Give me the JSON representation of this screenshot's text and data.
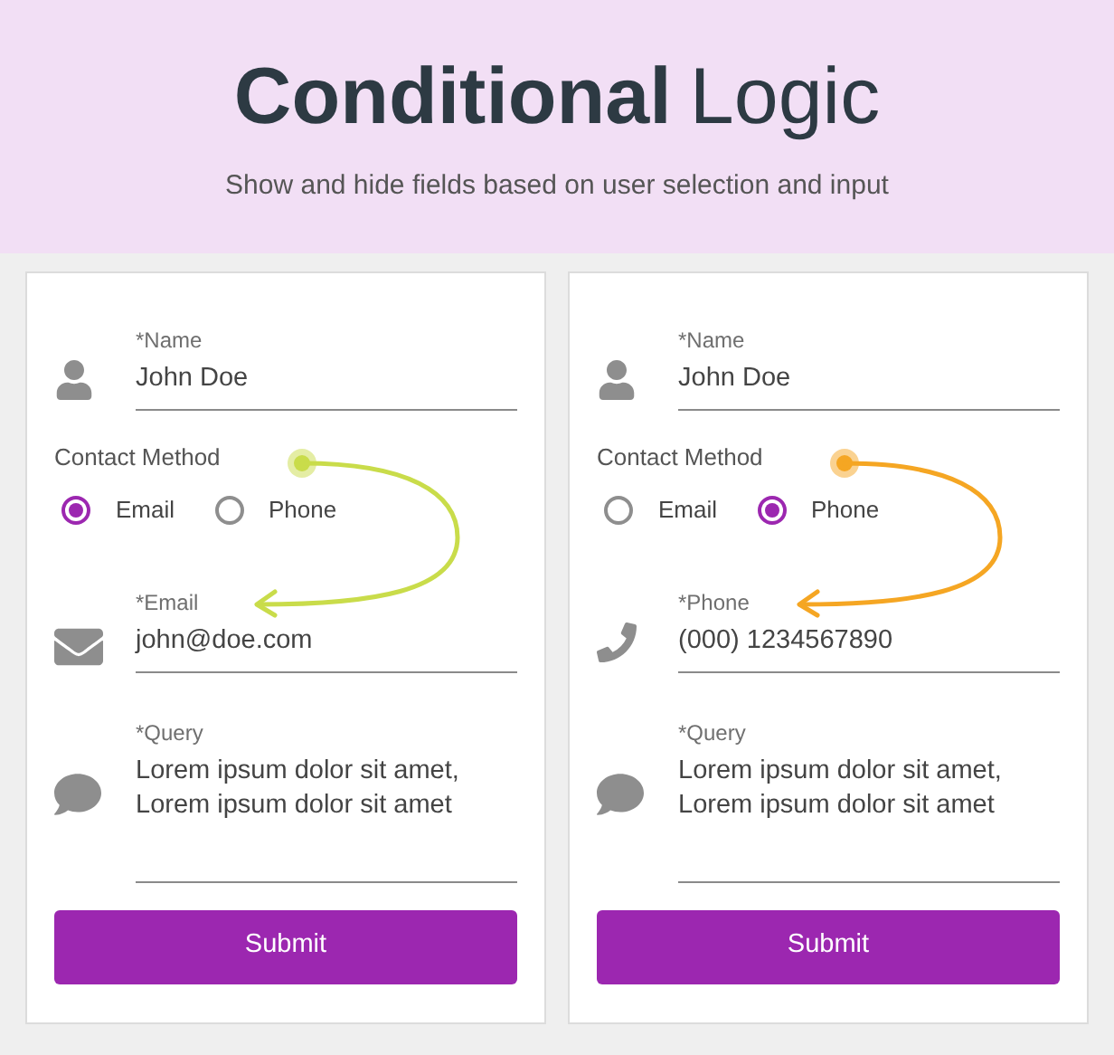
{
  "header": {
    "title_bold": "Conditional",
    "title_light": "Logic",
    "subtitle": "Show and hide fields based on user selection and input"
  },
  "forms": [
    {
      "color": "#c9dc4a",
      "fields_before": [
        {
          "kind": "name",
          "label": "*Name",
          "value": "John Doe"
        }
      ],
      "contact": {
        "label": "Contact Method",
        "options": [
          {
            "label": "Email",
            "selected": true
          },
          {
            "label": "Phone",
            "selected": false
          }
        ]
      },
      "fields_after": [
        {
          "kind": "email",
          "label": "*Email",
          "value": "john@doe.com"
        },
        {
          "kind": "query",
          "label": "*Query",
          "value": "Lorem ipsum dolor sit amet, Lorem ipsum dolor sit amet"
        }
      ],
      "submit": "Submit"
    },
    {
      "color": "#f5a623",
      "fields_before": [
        {
          "kind": "name",
          "label": "*Name",
          "value": "John Doe"
        }
      ],
      "contact": {
        "label": "Contact Method",
        "options": [
          {
            "label": "Email",
            "selected": false
          },
          {
            "label": "Phone",
            "selected": true
          }
        ]
      },
      "fields_after": [
        {
          "kind": "phone",
          "label": "*Phone",
          "value": "(000) 1234567890"
        },
        {
          "kind": "query",
          "label": "*Query",
          "value": "Lorem ipsum dolor sit amet, Lorem ipsum dolor sit amet"
        }
      ],
      "submit": "Submit"
    }
  ]
}
